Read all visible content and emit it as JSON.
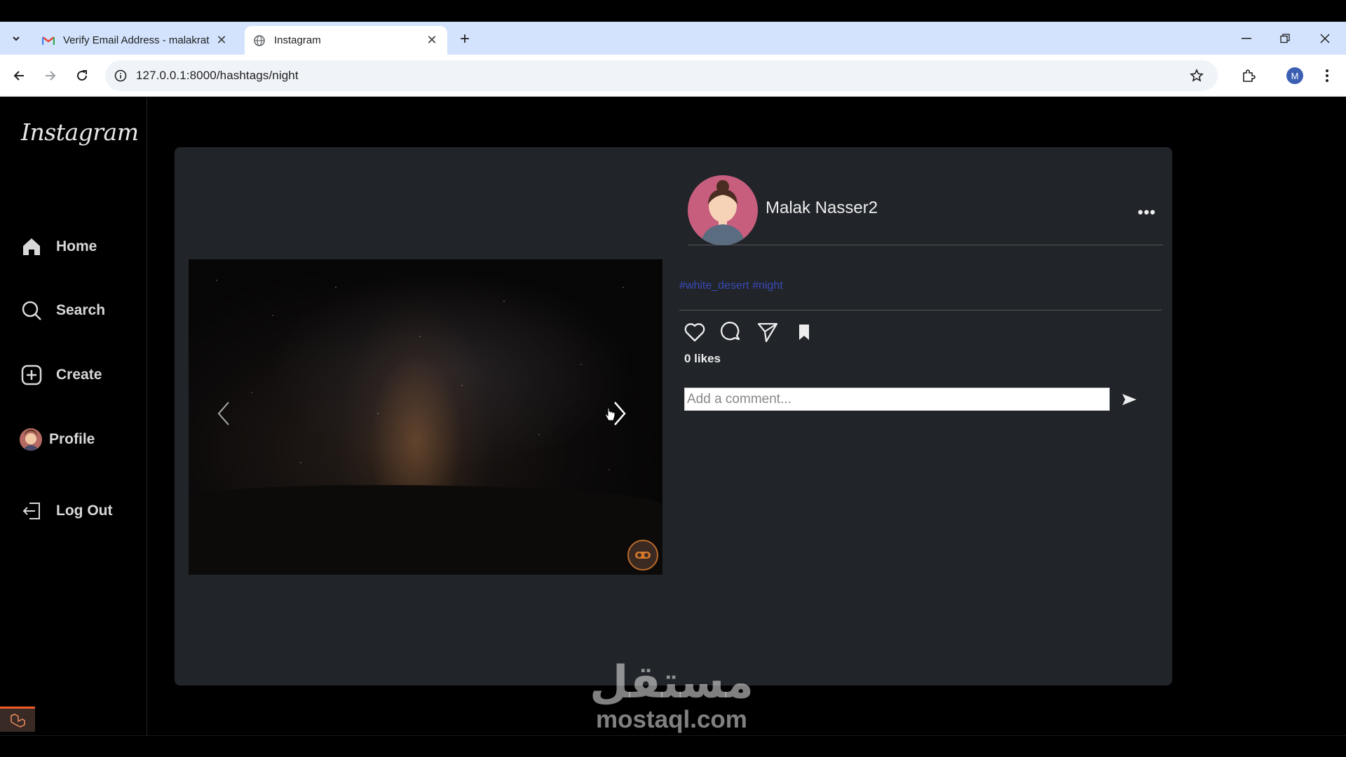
{
  "browser": {
    "tabs": [
      {
        "title": "Verify Email Address - malakrat",
        "favicon": "gmail-icon",
        "active": false
      },
      {
        "title": "Instagram",
        "favicon": "globe-icon",
        "active": true
      }
    ],
    "url": "127.0.0.1:8000/hashtags/night",
    "profile_initial": "M"
  },
  "sidebar": {
    "logo": "Instagram",
    "items": [
      {
        "label": "Home",
        "icon": "home-icon"
      },
      {
        "label": "Search",
        "icon": "search-icon"
      },
      {
        "label": "Create",
        "icon": "plus-square-icon"
      },
      {
        "label": "Profile",
        "icon": "avatar"
      },
      {
        "label": "Log Out",
        "icon": "logout-icon"
      }
    ]
  },
  "post": {
    "username": "Malak Nasser2",
    "caption": "#white_desert #night",
    "likes": "0 likes",
    "comment_placeholder": "Add a comment...",
    "more_glyph": "•••"
  },
  "watermark": {
    "arabic": "مستقل",
    "latin": "mostaql.com"
  },
  "colors": {
    "page_bg": "#000000",
    "card_bg": "#212529",
    "hashtag": "#3a49b8",
    "tabstrip": "#d3e3fd"
  }
}
